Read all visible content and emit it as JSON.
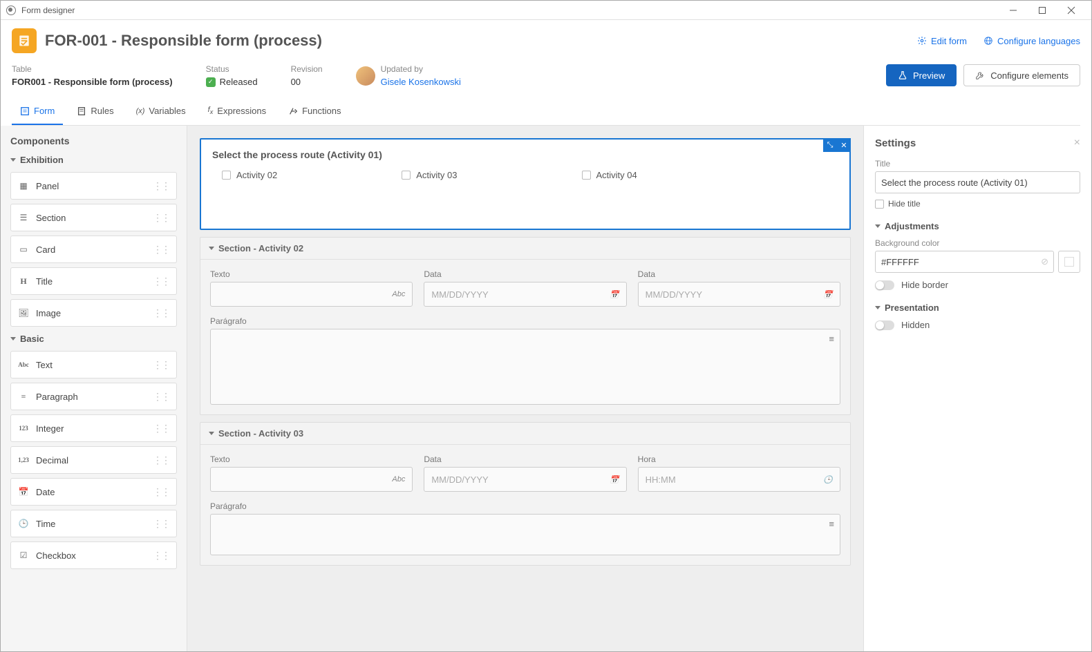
{
  "window": {
    "title": "Form designer"
  },
  "header": {
    "title": "FOR-001 - Responsible form (process)",
    "editLink": "Edit form",
    "configLangLink": "Configure languages",
    "table": {
      "label": "Table",
      "value": "FOR001 - Responsible form (process)"
    },
    "status": {
      "label": "Status",
      "value": "Released"
    },
    "revision": {
      "label": "Revision",
      "value": "00"
    },
    "updated": {
      "label": "Updated by",
      "value": "Gisele Kosenkowski"
    },
    "btnPreview": "Preview",
    "btnConfigure": "Configure elements"
  },
  "tabs": {
    "form": "Form",
    "rules": "Rules",
    "variables": "Variables",
    "expressions": "Expressions",
    "functions": "Functions"
  },
  "leftSidebar": {
    "title": "Components",
    "groupExhibition": "Exhibition",
    "groupBasic": "Basic",
    "items": {
      "panel": "Panel",
      "section": "Section",
      "card": "Card",
      "title": "Title",
      "image": "Image",
      "text": "Text",
      "paragraph": "Paragraph",
      "integer": "Integer",
      "decimal": "Decimal",
      "date": "Date",
      "time": "Time",
      "checkbox": "Checkbox"
    }
  },
  "canvas": {
    "selectedPanel": {
      "title": "Select the process route (Activity 01)",
      "options": [
        "Activity 02",
        "Activity 03",
        "Activity 04"
      ]
    },
    "section02": {
      "title": "Section - Activity 02",
      "fields": {
        "texto": "Texto",
        "data1": "Data",
        "data2": "Data",
        "paragrafo": "Parágrafo"
      },
      "placeholders": {
        "date": "MM/DD/YYYY",
        "abc": "Abc"
      }
    },
    "section03": {
      "title": "Section - Activity 03",
      "fields": {
        "texto": "Texto",
        "data": "Data",
        "hora": "Hora",
        "paragrafo": "Parágrafo"
      },
      "placeholders": {
        "date": "MM/DD/YYYY",
        "time": "HH:MM",
        "abc": "Abc"
      }
    }
  },
  "settings": {
    "title": "Settings",
    "titleLabel": "Title",
    "titleValue": "Select the process route (Activity 01)",
    "hideTitle": "Hide title",
    "adjustments": "Adjustments",
    "bgColorLabel": "Background color",
    "bgColorValue": "#FFFFFF",
    "hideBorder": "Hide border",
    "presentation": "Presentation",
    "hidden": "Hidden"
  }
}
